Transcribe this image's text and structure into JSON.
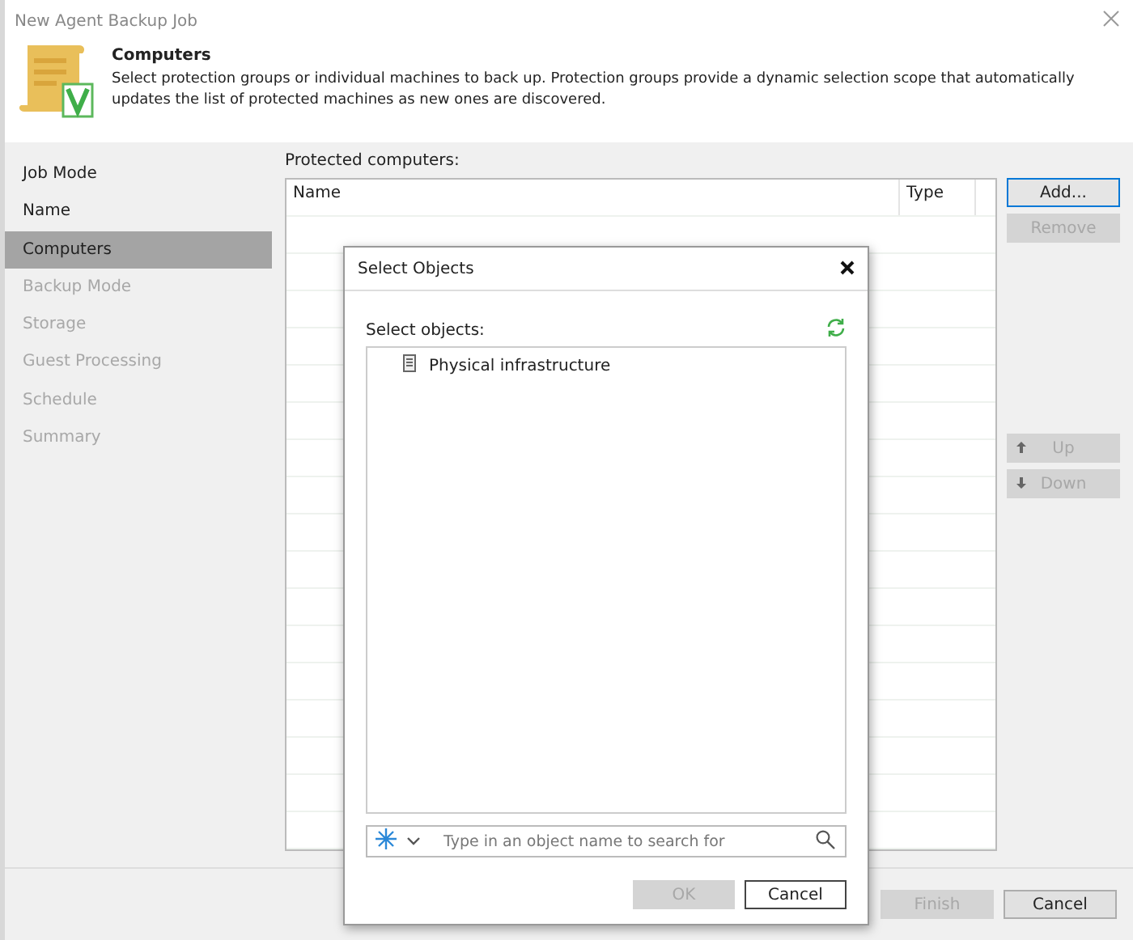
{
  "window": {
    "title": "New Agent Backup Job"
  },
  "header": {
    "title": "Computers",
    "description": "Select protection groups or individual machines to back up. Protection groups provide a dynamic selection scope that automatically updates the list of protected machines as new ones are discovered."
  },
  "sidebar": {
    "items": [
      {
        "label": "Job Mode",
        "selected": false,
        "disabled": false
      },
      {
        "label": "Name",
        "selected": false,
        "disabled": false
      },
      {
        "label": "Computers",
        "selected": true,
        "disabled": false
      },
      {
        "label": "Backup Mode",
        "selected": false,
        "disabled": true
      },
      {
        "label": "Storage",
        "selected": false,
        "disabled": true
      },
      {
        "label": "Guest Processing",
        "selected": false,
        "disabled": true
      },
      {
        "label": "Schedule",
        "selected": false,
        "disabled": true
      },
      {
        "label": "Summary",
        "selected": false,
        "disabled": true
      }
    ]
  },
  "protected_computers": {
    "label": "Protected computers:",
    "columns": [
      "Name",
      "Type"
    ]
  },
  "side_buttons": [
    {
      "label": "Add...",
      "disabled": false,
      "kind": "plain"
    },
    {
      "label": "Remove",
      "disabled": true,
      "kind": "plain"
    },
    {
      "label": "Up",
      "disabled": true,
      "kind": "up"
    },
    {
      "label": "Down",
      "disabled": true,
      "kind": "down"
    }
  ],
  "footer_buttons": [
    {
      "label": "Finish",
      "disabled": true
    },
    {
      "label": "Cancel",
      "disabled": false
    }
  ],
  "dialog": {
    "title": "Select Objects",
    "label": "Select objects:",
    "tree": [
      {
        "label": "Physical infrastructure"
      }
    ],
    "search": {
      "placeholder": "Type in an object name to search for"
    },
    "buttons": [
      {
        "label": "OK",
        "disabled": true
      },
      {
        "label": "Cancel",
        "disabled": false
      }
    ]
  }
}
